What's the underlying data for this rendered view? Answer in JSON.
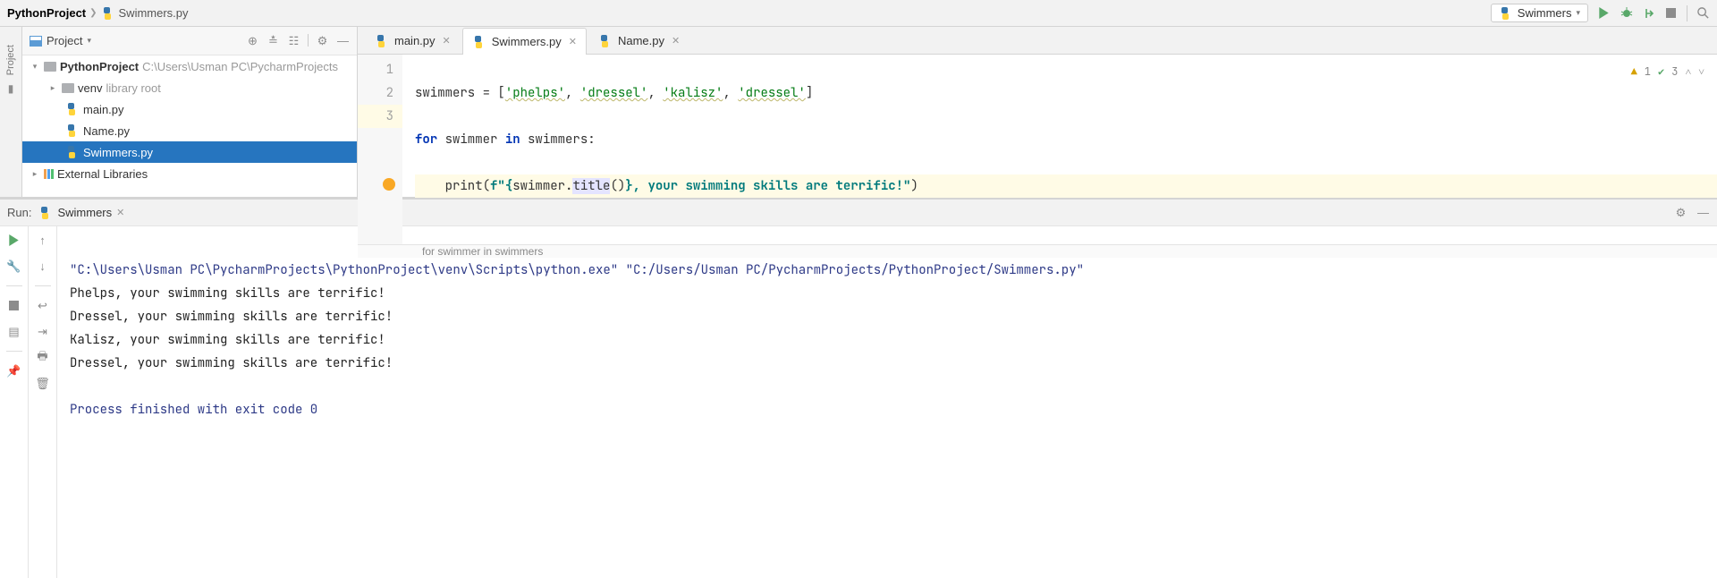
{
  "breadcrumb": {
    "project": "PythonProject",
    "file": "Swimmers.py"
  },
  "run_config": "Swimmers",
  "project_panel": {
    "title": "Project",
    "root": {
      "name": "PythonProject",
      "path": "C:\\Users\\Usman PC\\PycharmProjects"
    },
    "venv": {
      "name": "venv",
      "note": "library root"
    },
    "files": [
      "main.py",
      "Name.py",
      "Swimmers.py"
    ],
    "ext_lib": "External Libraries"
  },
  "tabs": [
    {
      "label": "main.py"
    },
    {
      "label": "Swimmers.py"
    },
    {
      "label": "Name.py"
    }
  ],
  "editor": {
    "line_numbers": [
      "1",
      "2",
      "3"
    ],
    "l1": {
      "a": "swimmers = [",
      "s1": "'phelps'",
      "c1": ", ",
      "s2": "'dressel'",
      "c2": ", ",
      "s3": "'kalisz'",
      "c3": ", ",
      "s4": "'dressel'",
      "b": "]"
    },
    "l2": {
      "kfor": "for",
      "a": " swimmer ",
      "kin": "in",
      "b": " swimmers:"
    },
    "l3": {
      "a": "    print(",
      "fpre": "f\"",
      "brace": "{",
      "id": "swimmer",
      "dot": ".",
      "m": "title",
      "par": "()",
      "brace2": "}",
      "tail": ", your swimming skills are terrific!\"",
      "close": ")"
    },
    "crumb": "for swimmer in swimmers",
    "inspect_warn": "1",
    "inspect_ok": "3"
  },
  "run": {
    "label": "Run:",
    "tab": "Swimmers",
    "output": {
      "cmd": "\"C:\\Users\\Usman PC\\PycharmProjects\\PythonProject\\venv\\Scripts\\python.exe\" \"C:/Users/Usman PC/PycharmProjects/PythonProject/Swimmers.py\"",
      "lines": [
        "Phelps, your swimming skills are terrific!",
        "Dressel, your swimming skills are terrific!",
        "Kalisz, your swimming skills are terrific!",
        "Dressel, your swimming skills are terrific!"
      ],
      "exit": "Process finished with exit code 0"
    }
  },
  "left_label": "Project"
}
